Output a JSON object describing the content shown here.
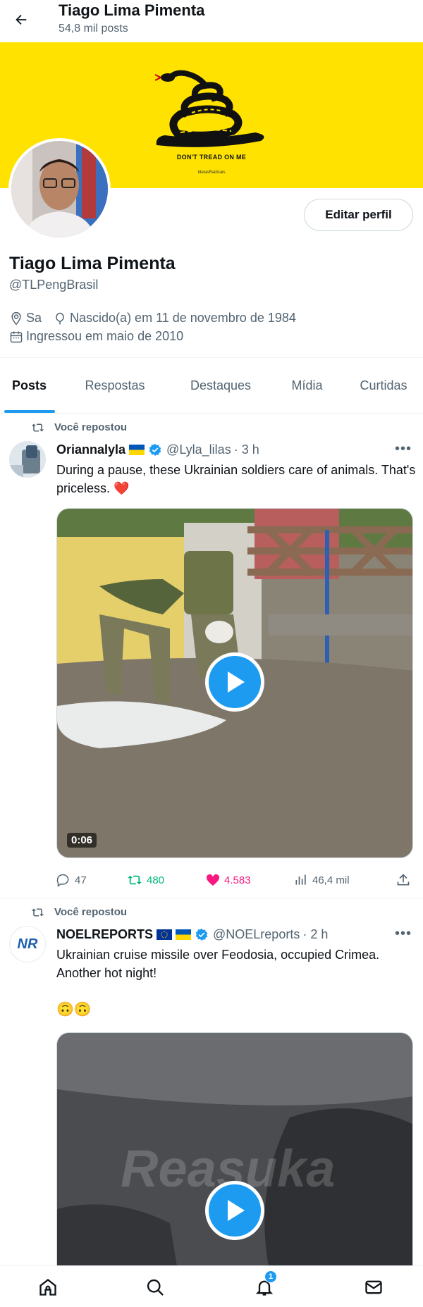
{
  "header": {
    "title": "Tiago Lima Pimenta",
    "post_count": "54,8 mil posts"
  },
  "banner": {
    "motto": "DON'T TREAD ON ME",
    "watermark": "IdeiasRadicais"
  },
  "profile": {
    "name": "Tiago Lima Pimenta",
    "handle": "@TLPengBrasil",
    "edit_label": "Editar perfil",
    "location": "Sa",
    "birth": "Nascido(a) em 11 de novembro de 1984",
    "joined": "Ingressou em maio de 2010"
  },
  "tabs": [
    {
      "label": "Posts",
      "active": true
    },
    {
      "label": "Respostas",
      "active": false
    },
    {
      "label": "Destaques",
      "active": false
    },
    {
      "label": "Mídia",
      "active": false
    },
    {
      "label": "Curtidas",
      "active": false
    }
  ],
  "posts": [
    {
      "repost_label": "Você repostou",
      "author": "Oriannalyla",
      "handle": "@Lyla_lilas",
      "time": "· 3 h",
      "text": "During a pause, these Ukrainian soldiers care of animals. That's priceless.",
      "emoji": "❤️",
      "video_duration": "0:06",
      "replies": "47",
      "reposts": "480",
      "likes": "4.583",
      "views": "46,4 mil"
    },
    {
      "repost_label": "Você repostou",
      "author": "NOELREPORTS",
      "handle": "@NOELreports",
      "time": "· 2 h",
      "text": "Ukrainian cruise missile over Feodosia, occupied Crimea. Another hot night!",
      "emoji": "🙃🙃",
      "avatar_text": "NR",
      "watermark": "Reasuka"
    }
  ],
  "nav": {
    "notifications_badge": "1"
  },
  "colors": {
    "accent": "#1d9bf0",
    "banner": "#ffe200",
    "repost_green": "#00ba7c",
    "like_pink": "#f91880"
  }
}
